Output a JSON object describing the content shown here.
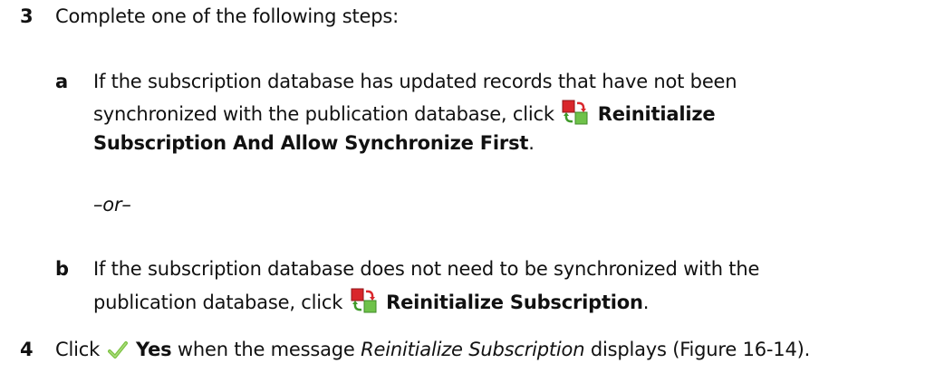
{
  "steps": {
    "step3": {
      "number": "3",
      "text": "Complete one of the following steps:",
      "a": {
        "letter": "a",
        "line1": "If the subscription database has updated records that have not been",
        "line2_prefix": "synchronized with the publication database, click",
        "line2_bold": "Reinitialize",
        "line3_bold": "Subscription And Allow Synchronize First",
        "line3_suffix": ".",
        "icon": "reinitialize-icon"
      },
      "or": "–or–",
      "b": {
        "letter": "b",
        "line1": "If the subscription database does not need to be synchronized with the",
        "line2_prefix": "publication database, click",
        "line2_bold": "Reinitialize Subscription",
        "line2_suffix": ".",
        "icon": "reinitialize-icon"
      }
    },
    "step4": {
      "number": "4",
      "prefix": "Click",
      "bold": "Yes",
      "middle": "when the message",
      "italic": "Reinitialize Subscription",
      "suffix": "displays (Figure 16-14).",
      "icon": "checkmark-icon"
    }
  },
  "colors": {
    "text": "#111111",
    "icon_red": "#d9262b",
    "icon_green": "#6fc24a",
    "check_green": "#7cc242"
  }
}
